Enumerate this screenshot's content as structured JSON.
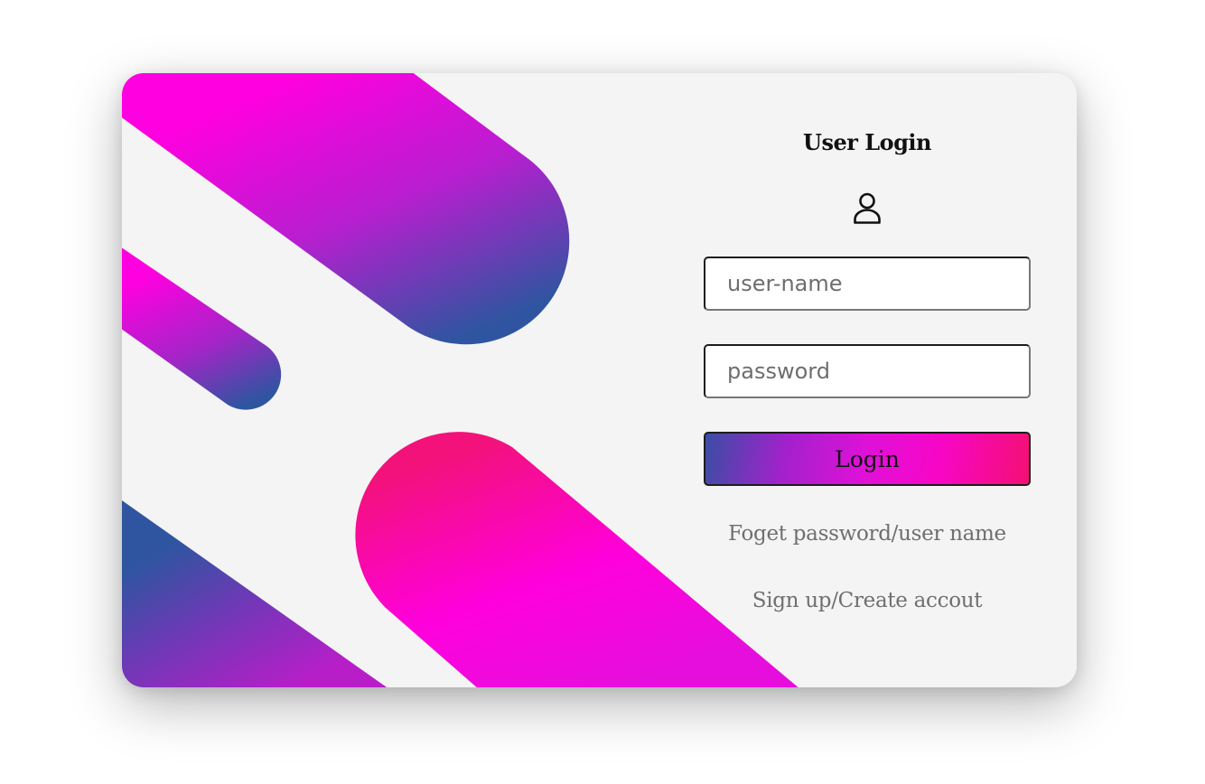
{
  "login": {
    "title": "User Login",
    "icon": "user-icon",
    "username_placeholder": "user-name",
    "password_placeholder": "password",
    "login_label": "Login",
    "forgot_link": "Foget password/user name",
    "signup_link": "Sign up/Create accout"
  },
  "colors": {
    "card_background": "#f4f4f4",
    "gradient_magenta": "#ff00dd",
    "gradient_blue": "#2f55a0",
    "gradient_pink": "#f31072",
    "link_gray": "#6f6f6f"
  }
}
